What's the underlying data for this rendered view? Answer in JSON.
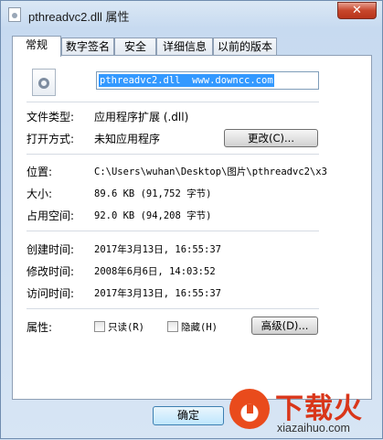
{
  "window": {
    "title": "pthreadvc2.dll 属性",
    "close_label": "✕"
  },
  "tabs": [
    {
      "label": "常规",
      "active": true
    },
    {
      "label": "数字签名",
      "active": false
    },
    {
      "label": "安全",
      "active": false
    },
    {
      "label": "详细信息",
      "active": false
    },
    {
      "label": "以前的版本",
      "active": false
    }
  ],
  "general": {
    "file_name": "pthreadvc2.dll  www.downcc.com",
    "type_label": "文件类型:",
    "type_value": "应用程序扩展 (.dll)",
    "opens_label": "打开方式:",
    "opens_value": "未知应用程序",
    "change_button": "更改(C)...",
    "location_label": "位置:",
    "location_value": "C:\\Users\\wuhan\\Desktop\\图片\\pthreadvc2\\x3",
    "size_label": "大小:",
    "size_value": "89.6 KB (91,752 字节)",
    "disk_label": "占用空间:",
    "disk_value": "92.0 KB (94,208 字节)",
    "created_label": "创建时间:",
    "created_value": "2017年3月13日, 16:55:37",
    "modified_label": "修改时间:",
    "modified_value": "2008年6月6日, 14:03:52",
    "accessed_label": "访问时间:",
    "accessed_value": "2017年3月13日, 16:55:37",
    "attributes_label": "属性:",
    "readonly_label": "只读(R)",
    "hidden_label": "隐藏(H)",
    "advanced_button": "高级(D)..."
  },
  "footer": {
    "ok_button": "确定"
  },
  "watermark": {
    "title": "下载火",
    "subtitle": "xiazaihuo.com",
    "brand_color": "#d9361a"
  }
}
